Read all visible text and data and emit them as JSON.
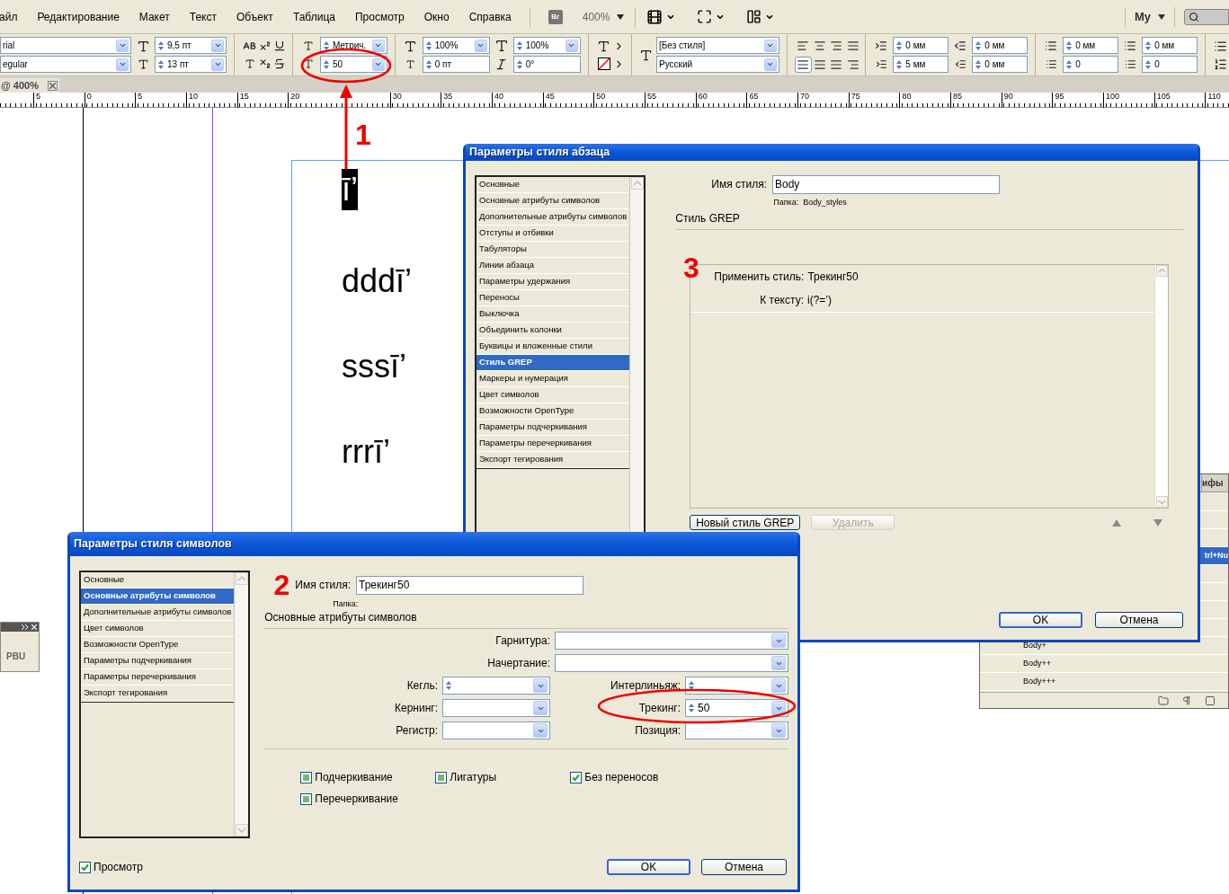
{
  "menu_bar": {
    "items": [
      "айл",
      "Редактирование",
      "Макет",
      "Текст",
      "Объект",
      "Таблица",
      "Просмотр",
      "Окно",
      "Справка"
    ],
    "bridge": "Br",
    "zoom": "400%",
    "workspace": "My"
  },
  "control_panel": {
    "font_family": "rial",
    "font_style": "egular",
    "font_size": "9,5 пт",
    "leading": "13 пт",
    "kerning": "Метрич.",
    "tracking": "50",
    "vertical_scale": "100%",
    "baseline_shift": "0 пт",
    "horizontal_scale": "100%",
    "skew": "0°",
    "paragraph_style": "[Без стиля]",
    "language": "Русский",
    "left_indent": "0 мм",
    "first_line_indent": "5 мм",
    "right_indent": "0 мм",
    "last_line_indent": "0 мм",
    "space_before": "0 мм",
    "drop_cap_lines": "0",
    "space_after": "0 мм",
    "drop_cap_chars": "0",
    "alignments": [
      {
        "selected": false
      },
      {
        "selected": false
      },
      {
        "selected": false
      },
      {
        "selected": false
      },
      {
        "selected": true
      },
      {
        "selected": false
      },
      {
        "selected": false
      },
      {
        "selected": false
      }
    ]
  },
  "document_tab": {
    "title": "@ 400%"
  },
  "ruler": {
    "labels": [
      "5",
      "0",
      "5",
      "10",
      "15",
      "20",
      "30",
      "35",
      "40",
      "45",
      "50",
      "55",
      "60",
      "65",
      "70",
      "75",
      "80",
      "85",
      "90",
      "95",
      "100",
      "105",
      "110"
    ]
  },
  "page": {
    "lines": [
      {
        "text": "ī’",
        "selected": true
      },
      {
        "text": "dddī’",
        "selected": false
      },
      {
        "text": "sssī’",
        "selected": false
      },
      {
        "text": "rrrī’",
        "selected": false
      }
    ]
  },
  "annotations": [
    "1",
    "2",
    "3"
  ],
  "floating_panel": {
    "label": "PBU"
  },
  "styles_panel": {
    "tab": "ифы",
    "rows": [
      {
        "label": "trl+Nu",
        "selected": true
      },
      {
        "label": "Body+",
        "selected": false
      },
      {
        "label": "Body++",
        "selected": false
      },
      {
        "label": "Body+++",
        "selected": false
      }
    ]
  },
  "paragraph_style_dialog": {
    "title": "Параметры стиля абзаца",
    "sections": [
      {
        "label": "Основные",
        "selected": false
      },
      {
        "label": "Основные атрибуты символов",
        "selected": false
      },
      {
        "label": "Дополнительные атрибуты символов",
        "selected": false
      },
      {
        "label": "Отступы и отбивки",
        "selected": false
      },
      {
        "label": "Табуляторы",
        "selected": false
      },
      {
        "label": "Линии абзаца",
        "selected": false
      },
      {
        "label": "Параметры удержания",
        "selected": false
      },
      {
        "label": "Переносы",
        "selected": false
      },
      {
        "label": "Выключка",
        "selected": false
      },
      {
        "label": "Объединить колонки",
        "selected": false
      },
      {
        "label": "Буквицы и вложенные стили",
        "selected": false
      },
      {
        "label": "Стиль GREP",
        "selected": true
      },
      {
        "label": "Маркеры и нумерация",
        "selected": false
      },
      {
        "label": "Цвет символов",
        "selected": false
      },
      {
        "label": "Возможности OpenType",
        "selected": false
      },
      {
        "label": "Параметры подчеркивания",
        "selected": false
      },
      {
        "label": "Параметры перечеркивания",
        "selected": false
      },
      {
        "label": "Экспорт тегирования",
        "selected": false
      }
    ],
    "name_label": "Имя стиля:",
    "name_value": "Body",
    "folder": "Папка:  Body_styles",
    "section_title": "Стиль GREP",
    "grep_rule": {
      "apply_label": "Применить стиль:",
      "apply_value": "Трекинг50",
      "text_label": "К тексту:",
      "text_value": "i(?=’)"
    },
    "buttons": [
      {
        "label": "Новый стиль GREP",
        "disabled": false
      },
      {
        "label": "Удалить",
        "disabled": true
      }
    ],
    "ok": "OK",
    "cancel": "Отмена"
  },
  "character_style_dialog": {
    "title": "Параметры стиля символов",
    "sections": [
      {
        "label": "Основные",
        "selected": false
      },
      {
        "label": "Основные атрибуты символов",
        "selected": true
      },
      {
        "label": "Дополнительные атрибуты символов",
        "selected": false
      },
      {
        "label": "Цвет символов",
        "selected": false
      },
      {
        "label": "Возможности OpenType",
        "selected": false
      },
      {
        "label": "Параметры подчеркивания",
        "selected": false
      },
      {
        "label": "Параметры перечеркивания",
        "selected": false
      },
      {
        "label": "Экспорт тегирования",
        "selected": false
      }
    ],
    "name_label": "Имя стиля:",
    "name_value": "Трекинг50",
    "folder": "Папка:",
    "section_title": "Основные атрибуты символов",
    "font_family_label": "Гарнитура:",
    "font_style_label": "Начертание:",
    "size_label": "Кегль:",
    "leading_label": "Интерлиньяж:",
    "kerning_label": "Кернинг:",
    "tracking_label": "Трекинг:",
    "tracking_value": "50",
    "case_label": "Регистр:",
    "position_label": "Позиция:",
    "options": [
      {
        "label": "Подчеркивание",
        "checked": false,
        "indeterminate": true
      },
      {
        "label": "Лигатуры",
        "checked": false,
        "indeterminate": true
      },
      {
        "label": "Без переносов",
        "checked": true,
        "indeterminate": false
      },
      {
        "label": "Перечеркивание",
        "checked": false,
        "indeterminate": true
      }
    ],
    "preview": {
      "label": "Просмотр",
      "checked": true
    },
    "ok": "OK",
    "cancel": "Отмена"
  }
}
